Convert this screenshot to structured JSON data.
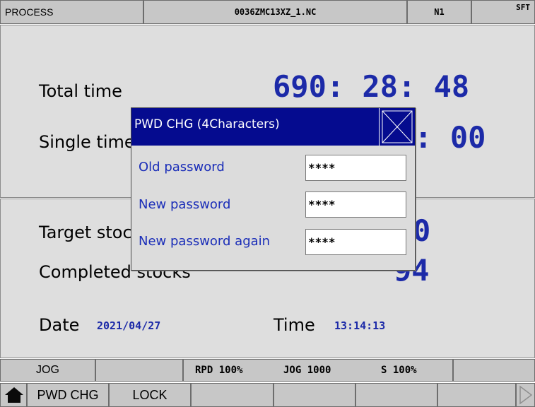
{
  "header": {
    "mode": "PROCESS",
    "filename": "0036ZMC13XZ_1.NC",
    "sequence": "N1",
    "shift": "SFT"
  },
  "process": {
    "total_time_label": "Total time",
    "total_time_value": "690: 28: 48",
    "single_time_label": "Single time",
    "single_time_value": "0: 00",
    "target_stocks_label": "Target stocks",
    "target_stocks_value": "0",
    "completed_stocks_label": "Completed stocks",
    "completed_stocks_value": "94",
    "date_label": "Date",
    "date_value": "2021/04/27",
    "time_label": "Time",
    "time_value": "13:14:13"
  },
  "status_bar": {
    "mode": "JOG",
    "rpd": "RPD 100%",
    "jog": "JOG 1000",
    "spindle": "S 100%"
  },
  "function_keys": {
    "home_icon": "home-icon",
    "f1": "PWD CHG",
    "f2": "LOCK",
    "next_icon": "triangle-right-icon"
  },
  "dialog": {
    "title": "PWD CHG  (4Characters)",
    "close_icon": "close-icon",
    "old_label": "Old password",
    "old_value": "****",
    "new_label": "New password",
    "new_value": "****",
    "again_label": "New password again",
    "again_value": "****"
  },
  "colors": {
    "accent_blue": "#1c2aa8",
    "dialog_title_bg": "#050b8f",
    "panel_bg": "#dedede",
    "bar_bg": "#c7c7c7"
  }
}
